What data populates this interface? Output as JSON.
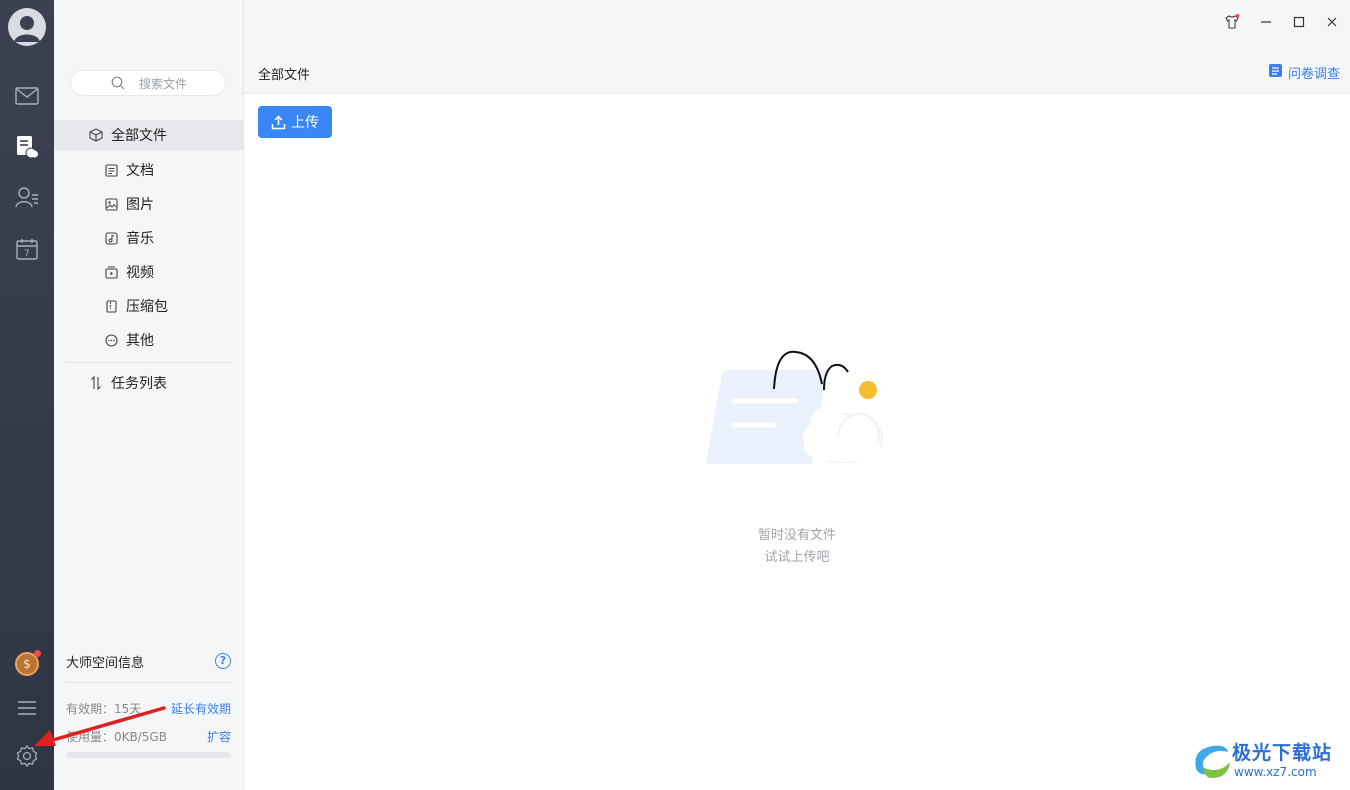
{
  "search": {
    "placeholder": "搜索文件"
  },
  "nav": {
    "all_files": "全部文件",
    "items": [
      {
        "label": "文档",
        "icon": "document-icon"
      },
      {
        "label": "图片",
        "icon": "image-icon"
      },
      {
        "label": "音乐",
        "icon": "music-icon"
      },
      {
        "label": "视频",
        "icon": "video-icon"
      },
      {
        "label": "压缩包",
        "icon": "archive-icon"
      },
      {
        "label": "其他",
        "icon": "more-icon"
      }
    ],
    "tasks": "任务列表"
  },
  "space": {
    "title": "大师空间信息",
    "validity_label": "有效期：15天",
    "extend_link": "延长有效期",
    "usage_label": "使用量：0KB/5GB",
    "expand_link": "扩容",
    "usage_fraction": 0.0
  },
  "header": {
    "title": "全部文件",
    "survey_link": "问卷调查"
  },
  "toolbar": {
    "upload_label": "上传"
  },
  "empty_state": {
    "line1": "暂时没有文件",
    "line2": "试试上传吧"
  },
  "watermark": {
    "brand": "极光下载站",
    "url": "www.xz7.com"
  },
  "colors": {
    "accent": "#3b86f5",
    "rail": "#343a47",
    "annotation": "#e02020"
  }
}
